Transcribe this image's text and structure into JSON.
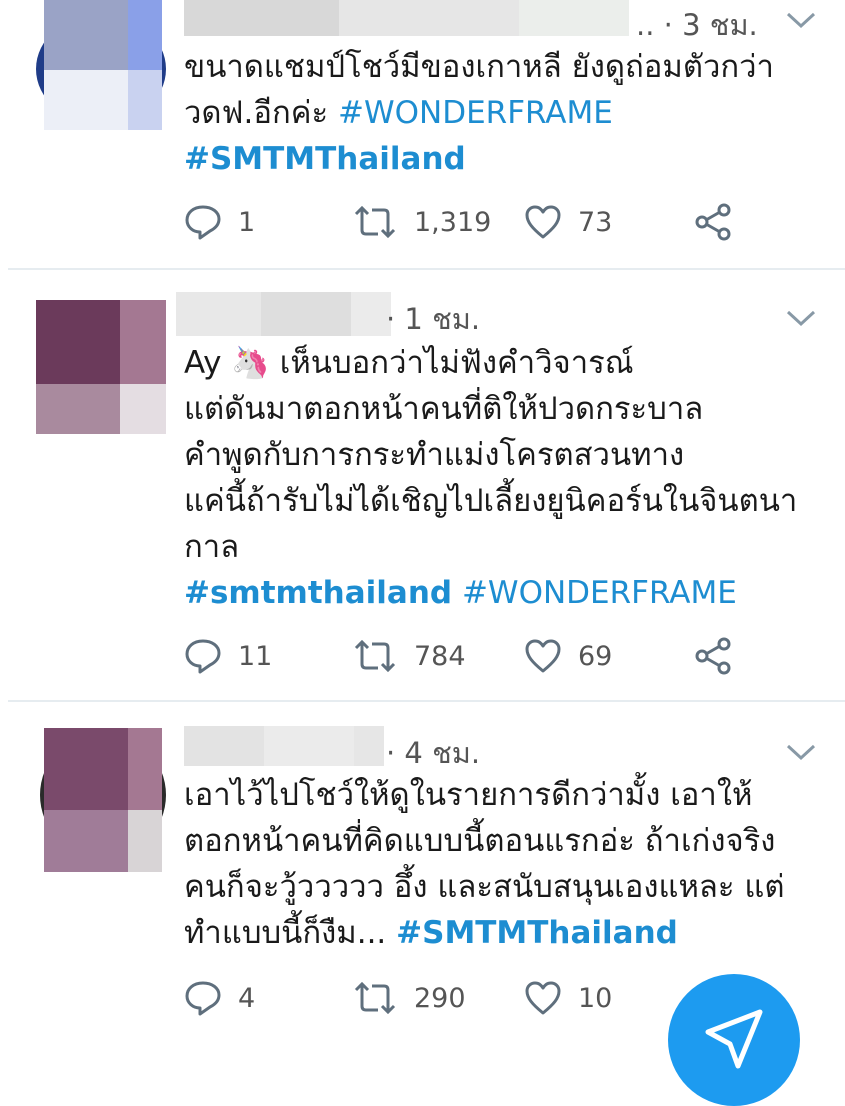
{
  "colors": {
    "accent": "#1d8dd1",
    "text": "#1a1a1a",
    "muted": "#555555",
    "separator": "#e6ecf0",
    "fab": "#1d9bf0"
  },
  "tweets": [
    {
      "time": ".. · 3 ชม.",
      "lines": [
        "ขนาดแชมป์โชว์มีของเกาหลี ยังดูถ่อมตัวกว่า",
        "วดฟ.อีกค่ะ"
      ],
      "tag_inline": "#WONDERFRAME",
      "tag_line": "#SMTMThailand",
      "replies": "1",
      "retweets": "1,319",
      "likes": "73"
    },
    {
      "time": "· 1 ชม.",
      "emoji": "🦄",
      "lines": [
        "Ay",
        "เห็นบอกว่าไม่ฟังคำวิจารณ์",
        "แต่ดันมาตอกหน้าคนที่ติให้ปวดกระบาล",
        "คำพูดกับการกระทำแม่งโครตสวนทาง",
        "แค่นี้ถ้ารับไม่ได้เชิญไปเลี้ยงยูนิคอร์นในจินตนา",
        "กาล"
      ],
      "tag_a": "#smtmthailand",
      "tag_b": "#WONDERFRAME",
      "replies": "11",
      "retweets": "784",
      "likes": "69"
    },
    {
      "time": "· 4 ชม.",
      "lines": [
        "เอาไว้ไปโชว์ให้ดูในรายการดีกว่ามั้ง เอาให้",
        "ตอกหน้าคนที่คิดแบบนี้ตอนแรกอ่ะ ถ้าเก่งจริง",
        "คนก็จะวู้ววววว อึ้ง และสนับสนุนเองแหละ แต่",
        "ทำแบบนี้ก็งืม..."
      ],
      "tag_inline": "#SMTMThailand",
      "replies": "4",
      "retweets": "290",
      "likes": "10"
    }
  ],
  "icons": {
    "reply": "reply-icon",
    "retweet": "retweet-icon",
    "like": "heart-icon",
    "share": "share-icon",
    "menu": "chevron-down-icon",
    "compose": "compose-icon"
  }
}
